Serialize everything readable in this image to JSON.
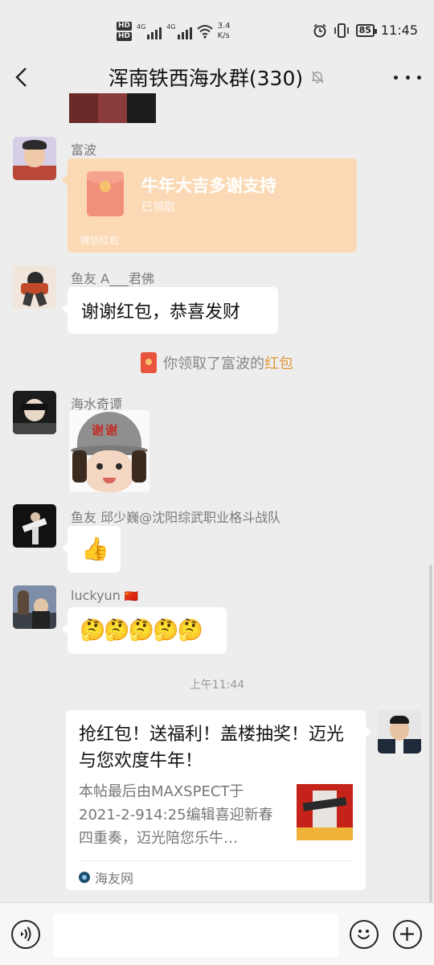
{
  "status_bar": {
    "network_speed_value": "3.4",
    "network_speed_unit": "K/s",
    "hd_label": "HD",
    "signal_label": "4G",
    "battery": "85",
    "time": "11:45"
  },
  "header": {
    "title": "浑南铁西海水群(330)"
  },
  "messages": {
    "m1": {
      "sender": "富波",
      "red_packet_title": "牛年大吉多谢支持",
      "red_packet_status": "已领取",
      "red_packet_footer": "微信红包"
    },
    "m2": {
      "sender": "鱼友 A___君佛",
      "text": "谢谢红包，恭喜发财"
    },
    "system": {
      "prefix": "你领取了富波的",
      "highlight": "红包"
    },
    "m3": {
      "sender": "海水奇谭",
      "sticker_text": "谢谢"
    },
    "m4": {
      "sender": "鱼友 邱少巍@沈阳综武职业格斗战队",
      "emoji": "👍"
    },
    "m5": {
      "sender": "luckyun",
      "sender_flag": "🇨🇳",
      "emoji": "🤔🤔🤔🤔🤔"
    },
    "timestamp": "上午11:44",
    "m6": {
      "card_title": "抢红包！送福利！盖楼抽奖！迈光与您欢度牛年！",
      "card_description": "本帖最后由MAXSPECT于2021-2-914:25编辑喜迎新春四重奏，迈光陪您乐牛…",
      "card_source": "海友网"
    }
  },
  "input": {
    "value": ""
  }
}
